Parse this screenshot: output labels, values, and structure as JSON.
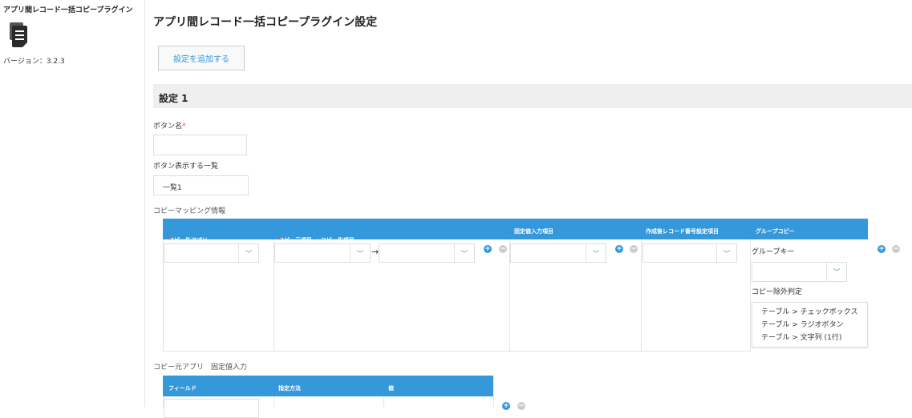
{
  "sidebar": {
    "plugin_title": "アプリ間レコード一括コピープラグイン",
    "version": "バージョン：3.2.3",
    "icon": "document-icon"
  },
  "page": {
    "title": "アプリ間レコード一括コピープラグイン設定",
    "add_button": "設定を追加する"
  },
  "setting": {
    "heading": "設定 1",
    "button_name_label": "ボタン名",
    "required_mark": "*",
    "button_name_value": "",
    "list_label": "ボタン表示する一覧",
    "list_value": "一覧1",
    "mapping_label": "コピーマッピング情報",
    "mapping_table": {
      "headers": {
        "dest_app": "コピー先アプリ",
        "src_dest": "コピー元項目 → コピー先項目",
        "fixed": "固定値入力項目",
        "record_no": "作成後レコード番号設定項目",
        "group": "グループコピー"
      },
      "arrow": "→",
      "group_key_label": "グループキー",
      "exclude_label": "コピー除外判定",
      "exclude_options": [
        "テーブル > チェックボックス",
        "テーブル > ラジオボタン",
        "テーブル > 文字列 (1行)"
      ]
    },
    "fixed_label": "コピー元アプリ　固定値入力",
    "fixed_table": {
      "headers": {
        "field": "フィールド",
        "method": "指定方法",
        "value": "値"
      }
    }
  },
  "icons": {
    "plus": "+",
    "minus": "−",
    "chevron": "﹀"
  },
  "colors": {
    "accent": "#3498db",
    "required": "#e74c3c"
  }
}
